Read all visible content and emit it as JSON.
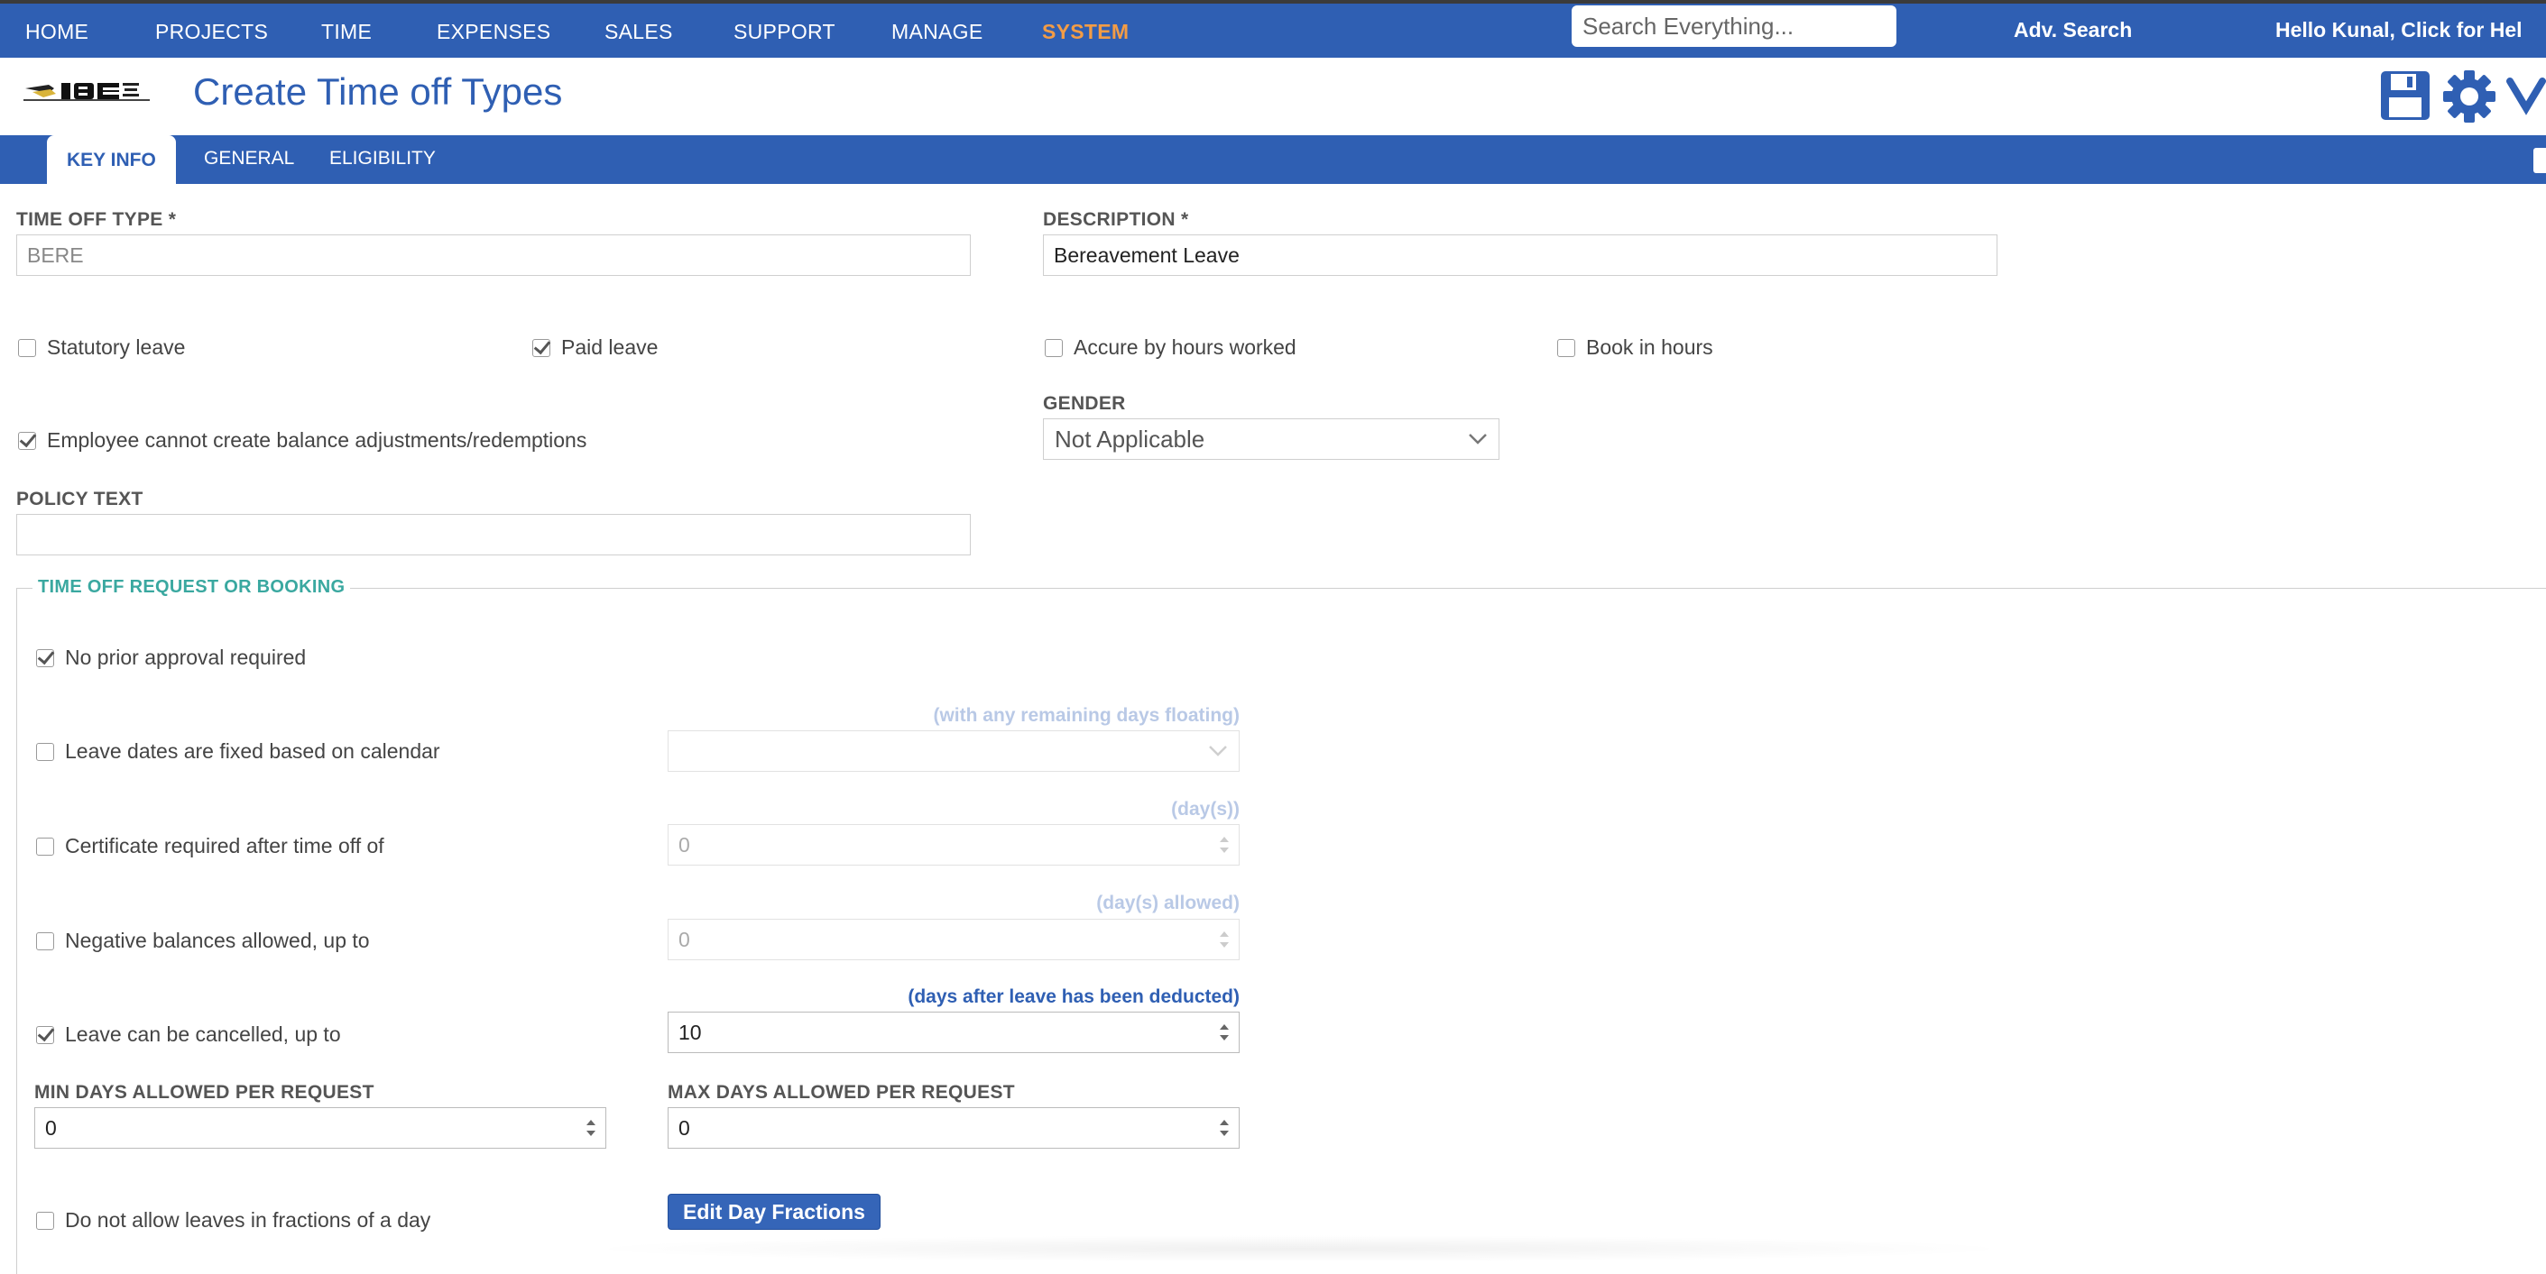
{
  "nav": {
    "items": [
      "HOME",
      "PROJECTS",
      "TIME",
      "EXPENSES",
      "SALES",
      "SUPPORT",
      "MANAGE",
      "SYSTEM"
    ],
    "active": "SYSTEM",
    "search_placeholder": "Search Everything...",
    "adv_search": "Adv. Search",
    "hello": "Hello Kunal, Click for Hel"
  },
  "header": {
    "title": "Create Time off Types",
    "icons": [
      "save-icon",
      "gear-icon",
      "chevron-down-icon"
    ]
  },
  "tabs": [
    "KEY INFO",
    "GENERAL",
    "ELIGIBILITY"
  ],
  "form": {
    "time_off_type": {
      "label": "TIME OFF TYPE *",
      "value": "BERE"
    },
    "description": {
      "label": "DESCRIPTION *",
      "value": "Bereavement Leave"
    },
    "checks": {
      "statutory": {
        "label": "Statutory leave",
        "checked": false
      },
      "paid": {
        "label": "Paid leave",
        "checked": true
      },
      "accrue": {
        "label": "Accure by hours worked",
        "checked": false
      },
      "book_hours": {
        "label": "Book in hours",
        "checked": false
      },
      "employee_cannot": {
        "label": "Employee cannot create balance adjustments/redemptions",
        "checked": true
      }
    },
    "gender": {
      "label": "GENDER",
      "value": "Not Applicable"
    },
    "policy_text": {
      "label": "POLICY TEXT",
      "value": ""
    }
  },
  "section": {
    "legend": "TIME OFF REQUEST OR BOOKING",
    "no_prior": {
      "label": "No prior approval required",
      "checked": true
    },
    "fixed_dates": {
      "label": "Leave dates are fixed based on calendar",
      "checked": false,
      "hint": "(with any remaining days floating)",
      "value": ""
    },
    "certificate": {
      "label": "Certificate required after time off of",
      "checked": false,
      "hint": "(day(s))",
      "value": "0"
    },
    "negative": {
      "label": "Negative balances allowed, up to",
      "checked": false,
      "hint": "(day(s) allowed)",
      "value": "0"
    },
    "cancel": {
      "label": "Leave can be cancelled, up to",
      "checked": true,
      "hint": "(days after leave has been deducted)",
      "value": "10"
    },
    "min_days": {
      "label": "MIN DAYS ALLOWED PER REQUEST",
      "value": "0"
    },
    "max_days": {
      "label": "MAX DAYS ALLOWED PER REQUEST",
      "value": "0"
    },
    "no_fractions": {
      "label": "Do not allow leaves in fractions of a day",
      "checked": false
    },
    "edit_day_fractions": "Edit Day Fractions"
  },
  "colors": {
    "nav_bg": "#2f5fb3",
    "active_nav": "#f39c45",
    "legend": "#3aa8a0",
    "hint": "#b9c9e6"
  }
}
